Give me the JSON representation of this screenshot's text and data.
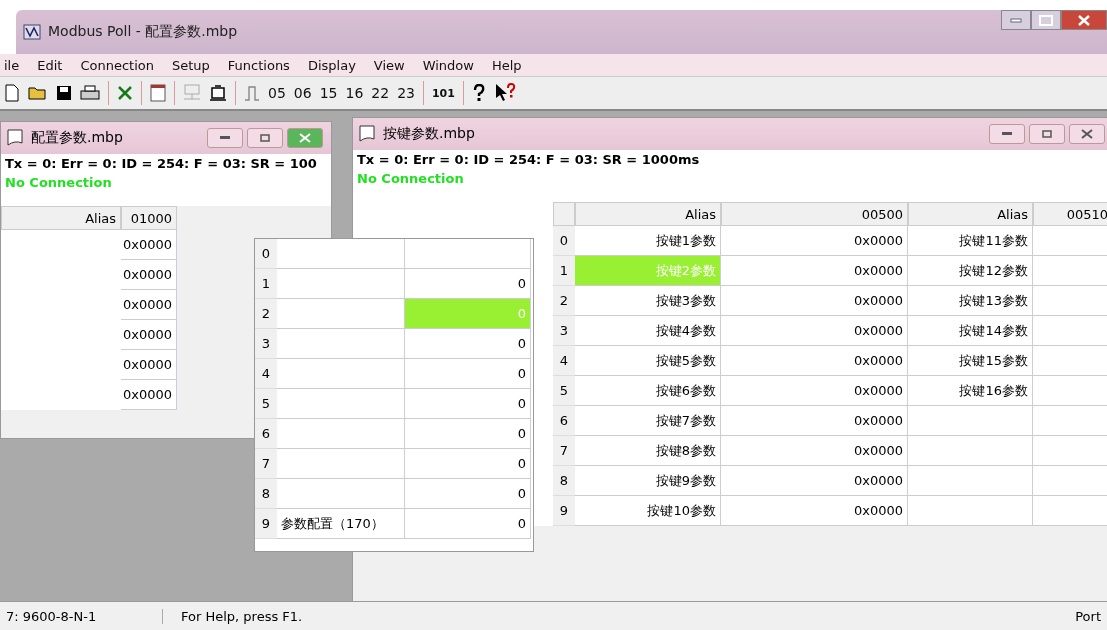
{
  "window": {
    "title": "Modbus Poll - 配置参数.mbp"
  },
  "menu": [
    {
      "label": "ile"
    },
    {
      "label": "Edit"
    },
    {
      "label": "Connection"
    },
    {
      "label": "Setup"
    },
    {
      "label": "Functions"
    },
    {
      "label": "Display"
    },
    {
      "label": "View"
    },
    {
      "label": "Window"
    },
    {
      "label": "Help"
    }
  ],
  "toolbar": {
    "function_codes": [
      "05",
      "06",
      "15",
      "16",
      "22",
      "23"
    ],
    "display_code": "101"
  },
  "config_window": {
    "title": "配置参数.mbp",
    "active": true,
    "status_line": "Tx = 0: Err = 0: ID = 254: F = 03: SR = 100",
    "connection": "No Connection",
    "columns": [
      "Alias",
      "01000"
    ],
    "values": [
      "0x0000",
      "0x0000",
      "0x0000",
      "0x0000",
      "0x0000",
      "0x0000"
    ]
  },
  "middle_table": {
    "rows": [
      {
        "number": "0",
        "selected": false
      },
      {
        "number": "1",
        "value": "0",
        "selected": false
      },
      {
        "number": "2",
        "value": "0",
        "selected": true
      },
      {
        "number": "3",
        "value": "0",
        "selected": false
      },
      {
        "number": "4",
        "value": "0",
        "selected": false
      },
      {
        "number": "5",
        "value": "0",
        "selected": false
      },
      {
        "number": "6",
        "value": "0",
        "selected": false
      },
      {
        "number": "7",
        "value": "0",
        "selected": false
      },
      {
        "number": "8",
        "value": "0",
        "selected": false
      },
      {
        "number": "9",
        "alias": "参数配置（170）",
        "value": "0",
        "selected": false
      }
    ]
  },
  "key_window": {
    "title": "按键参数.mbp",
    "active": false,
    "status_line": "Tx = 0: Err = 0: ID = 254: F = 03: SR = 1000ms",
    "connection": "No Connection",
    "columns": [
      "Alias",
      "00500",
      "Alias",
      "00510"
    ],
    "rows": [
      {
        "number": "0",
        "alias": "按键1参数",
        "value": "0x0000",
        "alias_2": "按键11参数",
        "selected": false
      },
      {
        "number": "1",
        "alias": "按键2参数",
        "value": "0x0000",
        "alias_2": "按键12参数",
        "selected": true
      },
      {
        "number": "2",
        "alias": "按键3参数",
        "value": "0x0000",
        "alias_2": "按键13参数",
        "selected": false
      },
      {
        "number": "3",
        "alias": "按键4参数",
        "value": "0x0000",
        "alias_2": "按键14参数",
        "selected": false
      },
      {
        "number": "4",
        "alias": "按键5参数",
        "value": "0x0000",
        "alias_2": "按键15参数",
        "selected": false
      },
      {
        "number": "5",
        "alias": "按键6参数",
        "value": "0x0000",
        "alias_2": "按键16参数",
        "selected": false
      },
      {
        "number": "6",
        "alias": "按键7参数",
        "value": "0x0000",
        "selected": false
      },
      {
        "number": "7",
        "alias": "按键8参数",
        "value": "0x0000",
        "selected": false
      },
      {
        "number": "8",
        "alias": "按键9参数",
        "value": "0x0000",
        "selected": false
      },
      {
        "number": "9",
        "alias": "按键10参数",
        "value": "0x0000",
        "selected": false
      }
    ]
  },
  "status_bar": {
    "port_settings": "7: 9600-8-N-1",
    "help": "For Help, press F1.",
    "port": "Port"
  }
}
